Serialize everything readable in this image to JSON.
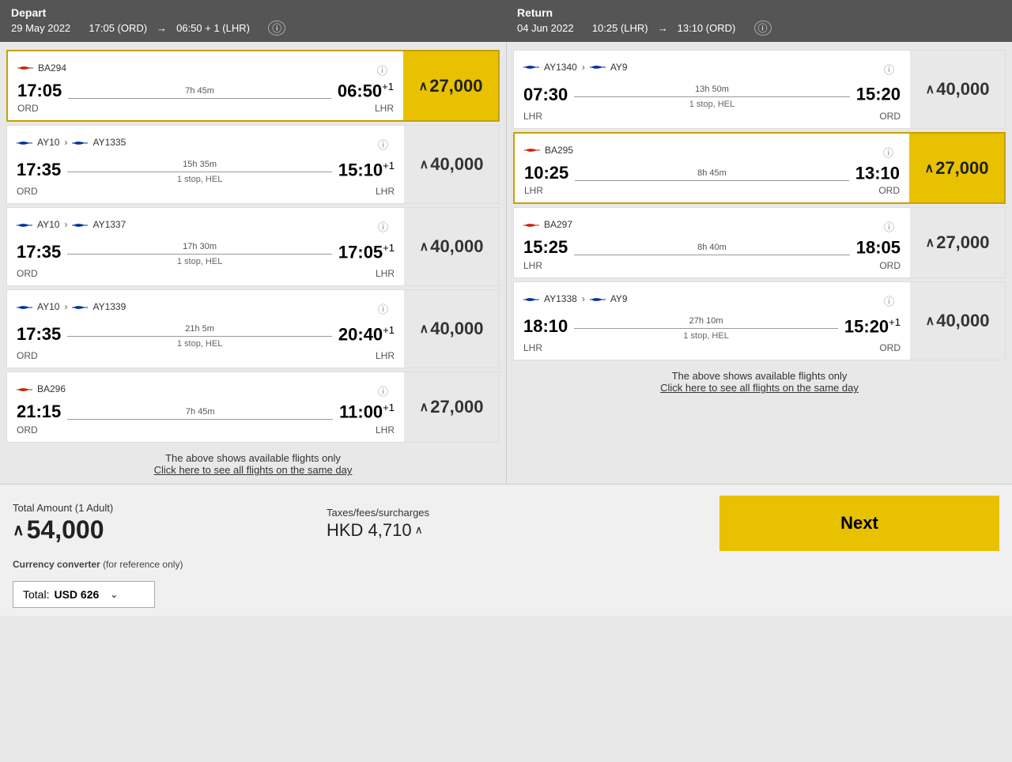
{
  "depart": {
    "header": {
      "label": "Depart",
      "date": "29 May 2022",
      "from": "17:05 (ORD)",
      "arrow": "→",
      "to": "06:50 + 1 (LHR)",
      "info_icon": "ⓘ"
    },
    "flights": [
      {
        "id": "depart-1",
        "selected": true,
        "airline_type": "ba",
        "flight_numbers": [
          "BA294"
        ],
        "time_from": "17:05",
        "duration": "7h 45m",
        "time_to": "06:50",
        "time_to_sup": "+1",
        "airport_from": "ORD",
        "airport_to": "LHR",
        "stop_info": "",
        "price": "27,000",
        "price_selected": true
      },
      {
        "id": "depart-2",
        "selected": false,
        "airline_type": "ay-ay",
        "flight_numbers": [
          "AY10",
          "AY1335"
        ],
        "time_from": "17:35",
        "duration": "15h 35m",
        "time_to": "15:10",
        "time_to_sup": "+1",
        "airport_from": "ORD",
        "airport_to": "LHR",
        "stop_info": "1 stop, HEL",
        "price": "40,000",
        "price_selected": false
      },
      {
        "id": "depart-3",
        "selected": false,
        "airline_type": "ay-ay",
        "flight_numbers": [
          "AY10",
          "AY1337"
        ],
        "time_from": "17:35",
        "duration": "17h 30m",
        "time_to": "17:05",
        "time_to_sup": "+1",
        "airport_from": "ORD",
        "airport_to": "LHR",
        "stop_info": "1 stop, HEL",
        "price": "40,000",
        "price_selected": false
      },
      {
        "id": "depart-4",
        "selected": false,
        "airline_type": "ay-ay",
        "flight_numbers": [
          "AY10",
          "AY1339"
        ],
        "time_from": "17:35",
        "duration": "21h 5m",
        "time_to": "20:40",
        "time_to_sup": "+1",
        "airport_from": "ORD",
        "airport_to": "LHR",
        "stop_info": "1 stop, HEL",
        "price": "40,000",
        "price_selected": false
      },
      {
        "id": "depart-5",
        "selected": false,
        "airline_type": "ba",
        "flight_numbers": [
          "BA296"
        ],
        "time_from": "21:15",
        "duration": "7h 45m",
        "time_to": "11:00",
        "time_to_sup": "+1",
        "airport_from": "ORD",
        "airport_to": "LHR",
        "stop_info": "",
        "price": "27,000",
        "price_selected": false
      }
    ],
    "note_line1": "The above shows available flights only",
    "note_line2": "Click here to see all flights on the same day"
  },
  "return": {
    "header": {
      "label": "Return",
      "date": "04 Jun 2022",
      "from": "10:25 (LHR)",
      "arrow": "→",
      "to": "13:10 (ORD)",
      "info_icon": "ⓘ"
    },
    "flights": [
      {
        "id": "return-1",
        "selected": false,
        "airline_type": "ay-ay",
        "flight_numbers": [
          "AY1340",
          "AY9"
        ],
        "time_from": "07:30",
        "duration": "13h 50m",
        "time_to": "15:20",
        "time_to_sup": "",
        "airport_from": "LHR",
        "airport_to": "ORD",
        "stop_info": "1 stop, HEL",
        "price": "40,000",
        "price_selected": false
      },
      {
        "id": "return-2",
        "selected": true,
        "airline_type": "ba",
        "flight_numbers": [
          "BA295"
        ],
        "time_from": "10:25",
        "duration": "8h 45m",
        "time_to": "13:10",
        "time_to_sup": "",
        "airport_from": "LHR",
        "airport_to": "ORD",
        "stop_info": "",
        "price": "27,000",
        "price_selected": true
      },
      {
        "id": "return-3",
        "selected": false,
        "airline_type": "ba",
        "flight_numbers": [
          "BA297"
        ],
        "time_from": "15:25",
        "duration": "8h 40m",
        "time_to": "18:05",
        "time_to_sup": "",
        "airport_from": "LHR",
        "airport_to": "ORD",
        "stop_info": "",
        "price": "27,000",
        "price_selected": false
      },
      {
        "id": "return-4",
        "selected": false,
        "airline_type": "ay-ay",
        "flight_numbers": [
          "AY1338",
          "AY9"
        ],
        "time_from": "18:10",
        "duration": "27h 10m",
        "time_to": "15:20",
        "time_to_sup": "+1",
        "airport_from": "LHR",
        "airport_to": "ORD",
        "stop_info": "1 stop, HEL",
        "price": "40,000",
        "price_selected": false
      }
    ],
    "note_line1": "The above shows available flights only",
    "note_line2": "Click here to see all flights on the same day"
  },
  "bottom": {
    "total_label": "Total Amount (1 Adult)",
    "total_amount": "54,000",
    "taxes_label": "Taxes/fees/surcharges",
    "taxes_amount": "HKD 4,710",
    "taxes_up_icon": "∧",
    "next_button": "Next",
    "currency_label": "Currency converter",
    "currency_note": "(for reference only)",
    "total_text": "Total:",
    "currency_value": "USD 626"
  }
}
